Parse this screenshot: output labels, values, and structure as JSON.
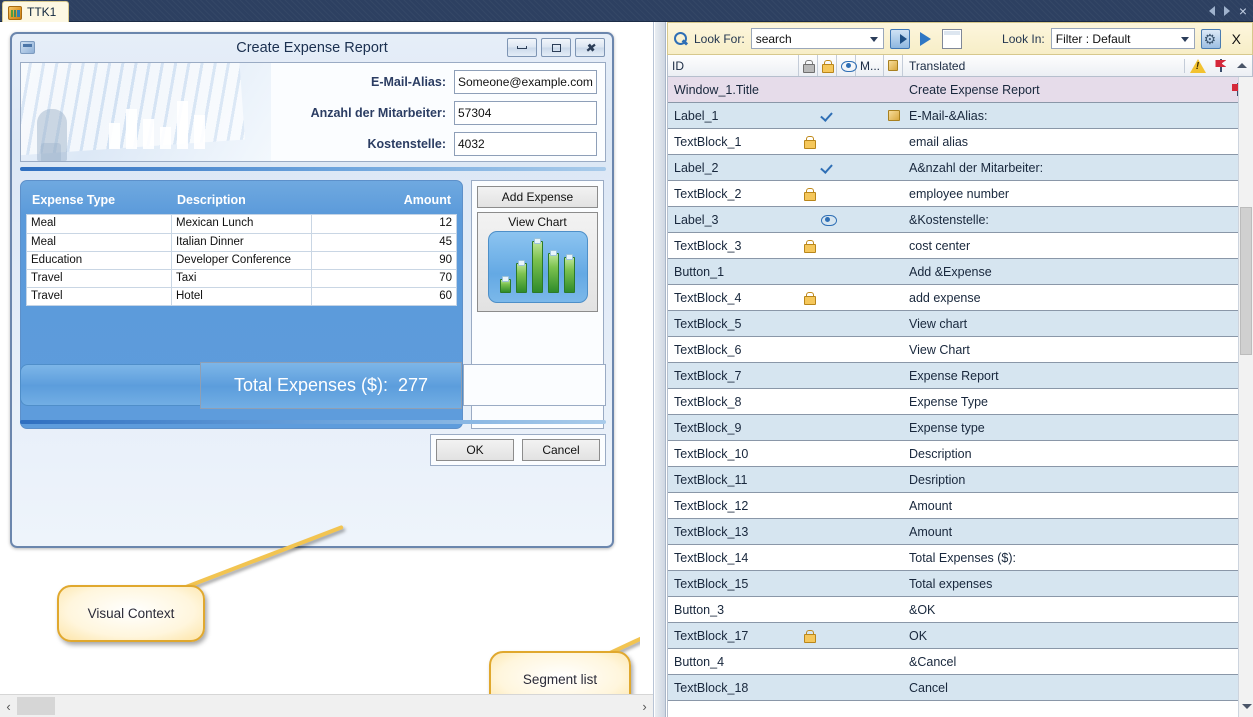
{
  "tabbar": {
    "active_tab": "TTK1",
    "nav_prev": "prev",
    "nav_next": "next",
    "close": "×"
  },
  "mock_window": {
    "title": "Create Expense Report",
    "minimize": "minimize",
    "maximize": "maximize",
    "close": "close",
    "form": {
      "rows": [
        {
          "label": "E-Mail-Alias:",
          "value": "Someone@example.com"
        },
        {
          "label": "Anzahl der Mitarbeiter:",
          "value": "57304"
        },
        {
          "label": "Kostenstelle:",
          "value": "4032"
        }
      ]
    },
    "grid": {
      "headers": [
        "Expense Type",
        "Description",
        "Amount"
      ],
      "rows": [
        [
          "Meal",
          "Mexican Lunch",
          "12"
        ],
        [
          "Meal",
          "Italian Dinner",
          "45"
        ],
        [
          "Education",
          "Developer Conference",
          "90"
        ],
        [
          "Travel",
          "Taxi",
          "70"
        ],
        [
          "Travel",
          "Hotel",
          "60"
        ]
      ]
    },
    "side_buttons": {
      "add_expense": "Add Expense",
      "view_chart": "View Chart",
      "chart_bars": [
        14,
        30,
        52,
        40,
        36
      ]
    },
    "total": {
      "label": "Total Expenses ($):",
      "value": "277"
    },
    "footer": {
      "ok": "OK",
      "cancel": "Cancel"
    }
  },
  "callouts": [
    {
      "text": "Visual Context"
    },
    {
      "text": "Segment list"
    }
  ],
  "toolbar": {
    "search_icon": "search-icon",
    "look_for_label": "Look For:",
    "look_for_value": "search",
    "find_next_icon": "find-next-icon",
    "play_icon": "play-icon",
    "blank_icon": "blank-window-icon",
    "look_in_label": "Look In:",
    "look_in_value": "Filter : Default",
    "settings_icon": "settings-icon",
    "close_label": "X"
  },
  "grid_header": {
    "id": "ID",
    "lock_gray": "lock-gray-icon",
    "lock_orange": "lock-orange-icon",
    "eye": "eye-icon",
    "m_col": "M...",
    "tan_square": "tan-square-icon",
    "translated": "Translated",
    "warning": "warning-icon",
    "flag": "flag-icon",
    "chevron": "chevron-up-icon"
  },
  "segments": [
    {
      "id": "Window_1.Title",
      "text": "Create Expense Report",
      "style": "title",
      "check": false,
      "lock": false,
      "eye": false,
      "square": false,
      "flag": true
    },
    {
      "id": "Label_1",
      "text": "E-Mail-&Alias:",
      "style": "alt",
      "check": true,
      "lock": false,
      "eye": false,
      "square": true,
      "flag": false
    },
    {
      "id": "TextBlock_1",
      "text": "email alias",
      "style": "norm",
      "check": false,
      "lock": true,
      "eye": false,
      "square": false,
      "flag": false
    },
    {
      "id": "Label_2",
      "text": "A&nzahl der Mitarbeiter:",
      "style": "alt",
      "check": true,
      "lock": false,
      "eye": false,
      "square": false,
      "flag": false
    },
    {
      "id": "TextBlock_2",
      "text": "employee number",
      "style": "norm",
      "check": false,
      "lock": true,
      "eye": false,
      "square": false,
      "flag": false
    },
    {
      "id": "Label_3",
      "text": "&Kostenstelle:",
      "style": "alt",
      "check": false,
      "lock": false,
      "eye": true,
      "square": false,
      "flag": false
    },
    {
      "id": "TextBlock_3",
      "text": "cost center",
      "style": "norm",
      "check": false,
      "lock": true,
      "eye": false,
      "square": false,
      "flag": false
    },
    {
      "id": "Button_1",
      "text": "Add &Expense",
      "style": "alt",
      "check": false,
      "lock": false,
      "eye": false,
      "square": false,
      "flag": false
    },
    {
      "id": "TextBlock_4",
      "text": "add expense",
      "style": "norm",
      "check": false,
      "lock": true,
      "eye": false,
      "square": false,
      "flag": false
    },
    {
      "id": "TextBlock_5",
      "text": "View chart",
      "style": "alt",
      "check": false,
      "lock": false,
      "eye": false,
      "square": false,
      "flag": false
    },
    {
      "id": "TextBlock_6",
      "text": "View Chart",
      "style": "norm",
      "check": false,
      "lock": false,
      "eye": false,
      "square": false,
      "flag": false
    },
    {
      "id": "TextBlock_7",
      "text": "Expense Report",
      "style": "alt",
      "check": false,
      "lock": false,
      "eye": false,
      "square": false,
      "flag": false
    },
    {
      "id": "TextBlock_8",
      "text": "Expense Type",
      "style": "norm",
      "check": false,
      "lock": false,
      "eye": false,
      "square": false,
      "flag": false
    },
    {
      "id": "TextBlock_9",
      "text": "Expense type",
      "style": "alt",
      "check": false,
      "lock": false,
      "eye": false,
      "square": false,
      "flag": false
    },
    {
      "id": "TextBlock_10",
      "text": "Description",
      "style": "norm",
      "check": false,
      "lock": false,
      "eye": false,
      "square": false,
      "flag": false
    },
    {
      "id": "TextBlock_11",
      "text": "Desription",
      "style": "alt",
      "check": false,
      "lock": false,
      "eye": false,
      "square": false,
      "flag": false
    },
    {
      "id": "TextBlock_12",
      "text": "Amount",
      "style": "norm",
      "check": false,
      "lock": false,
      "eye": false,
      "square": false,
      "flag": false
    },
    {
      "id": "TextBlock_13",
      "text": "Amount",
      "style": "alt",
      "check": false,
      "lock": false,
      "eye": false,
      "square": false,
      "flag": false
    },
    {
      "id": "TextBlock_14",
      "text": "Total Expenses ($):",
      "style": "norm",
      "check": false,
      "lock": false,
      "eye": false,
      "square": false,
      "flag": false
    },
    {
      "id": "TextBlock_15",
      "text": "Total expenses",
      "style": "alt",
      "check": false,
      "lock": false,
      "eye": false,
      "square": false,
      "flag": false
    },
    {
      "id": "Button_3",
      "text": "&OK",
      "style": "norm",
      "check": false,
      "lock": false,
      "eye": false,
      "square": false,
      "flag": false
    },
    {
      "id": "TextBlock_17",
      "text": "OK",
      "style": "alt",
      "check": false,
      "lock": true,
      "eye": false,
      "square": false,
      "flag": false
    },
    {
      "id": "Button_4",
      "text": "&Cancel",
      "style": "norm",
      "check": false,
      "lock": false,
      "eye": false,
      "square": false,
      "flag": false
    },
    {
      "id": "TextBlock_18",
      "text": "Cancel",
      "style": "alt",
      "check": false,
      "lock": false,
      "eye": false,
      "square": false,
      "flag": false
    }
  ],
  "scrollbars": {
    "h_left_arrow": "‹",
    "h_right_arrow": "›",
    "v_down_arrow": "chevron-down-icon"
  }
}
